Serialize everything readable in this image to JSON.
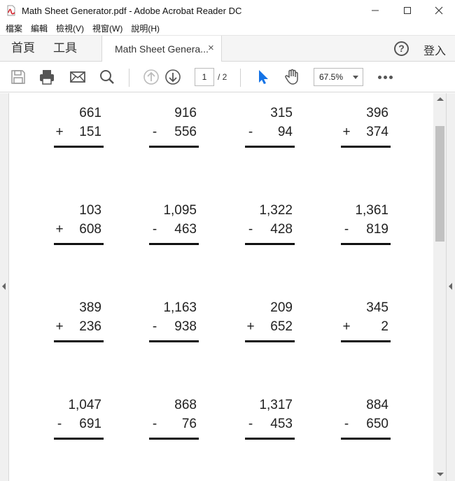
{
  "window": {
    "title": "Math Sheet Generator.pdf - Adobe Acrobat Reader DC",
    "controls": {
      "minimize": "—",
      "maximize": "☐",
      "close": "✕"
    }
  },
  "menu": [
    {
      "label": "檔案"
    },
    {
      "label": "編輯"
    },
    {
      "label": "檢視(V)"
    },
    {
      "label": "視窗(W)"
    },
    {
      "label": "說明(H)"
    }
  ],
  "tabs": {
    "home": "首頁",
    "tools": "工具",
    "document": "Math Sheet Genera...",
    "close": "×",
    "help": "?",
    "signin": "登入"
  },
  "toolbar": {
    "page_current": "1",
    "page_total": "/ 2",
    "zoom": "67.5%"
  },
  "colors": {
    "accent": "#1473e6",
    "icon": "#555555",
    "scroll_thumb": "#c1c1c1"
  },
  "problems": [
    [
      {
        "top": "661",
        "op": "+",
        "bottom": "151"
      },
      {
        "top": "916",
        "op": "-",
        "bottom": "556"
      },
      {
        "top": "315",
        "op": "-",
        "bottom": "94"
      },
      {
        "top": "396",
        "op": "+",
        "bottom": "374"
      }
    ],
    [
      {
        "top": "103",
        "op": "+",
        "bottom": "608"
      },
      {
        "top": "1,095",
        "op": "-",
        "bottom": "463"
      },
      {
        "top": "1,322",
        "op": "-",
        "bottom": "428"
      },
      {
        "top": "1,361",
        "op": "-",
        "bottom": "819"
      }
    ],
    [
      {
        "top": "389",
        "op": "+",
        "bottom": "236"
      },
      {
        "top": "1,163",
        "op": "-",
        "bottom": "938"
      },
      {
        "top": "209",
        "op": "+",
        "bottom": "652"
      },
      {
        "top": "345",
        "op": "+",
        "bottom": "2"
      }
    ],
    [
      {
        "top": "1,047",
        "op": "-",
        "bottom": "691"
      },
      {
        "top": "868",
        "op": "-",
        "bottom": "76"
      },
      {
        "top": "1,317",
        "op": "-",
        "bottom": "453"
      },
      {
        "top": "884",
        "op": "-",
        "bottom": "650"
      }
    ]
  ]
}
